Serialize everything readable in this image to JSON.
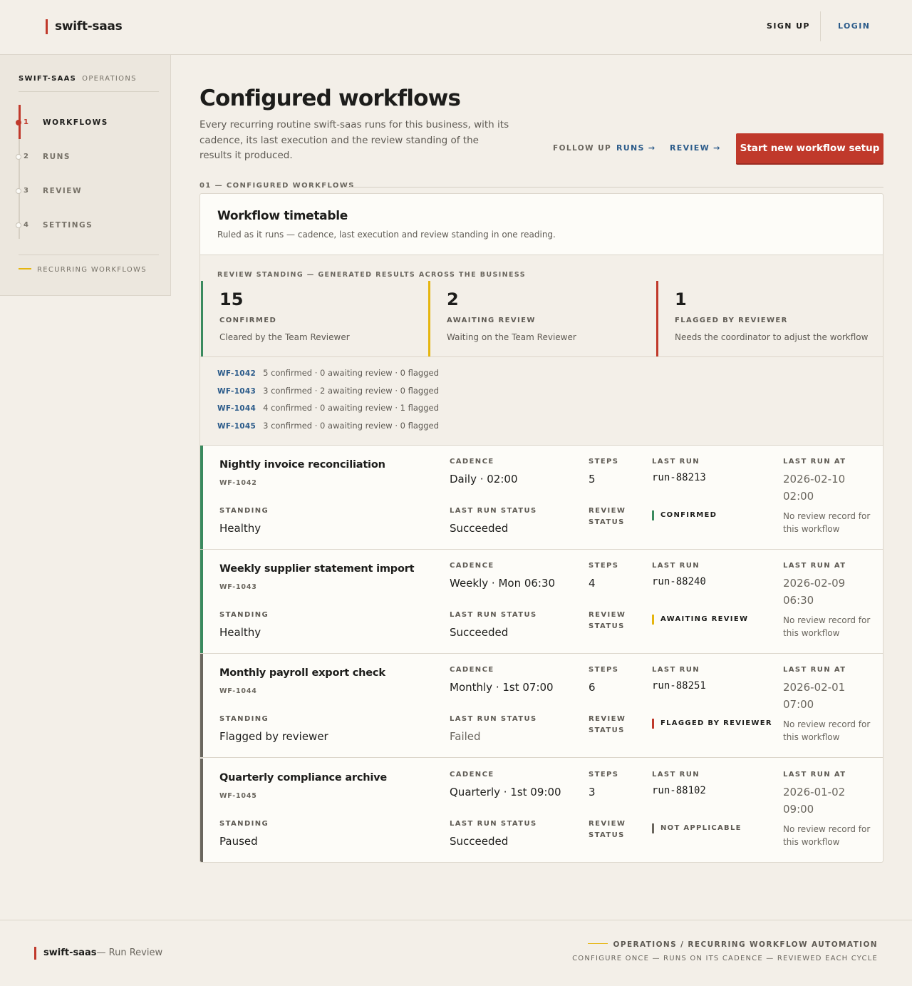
{
  "header": {
    "brand": "swift-saas",
    "signup": "SIGN UP",
    "login": "LOGIN"
  },
  "sidebar": {
    "title_a": "SWIFT-SAAS",
    "title_b": "OPERATIONS",
    "items": [
      {
        "num": "1",
        "label": "WORKFLOWS",
        "active": true
      },
      {
        "num": "2",
        "label": "RUNS",
        "active": false
      },
      {
        "num": "3",
        "label": "REVIEW",
        "active": false
      },
      {
        "num": "4",
        "label": "SETTINGS",
        "active": false
      }
    ],
    "footer": "RECURRING WORKFLOWS"
  },
  "main": {
    "title": "Configured workflows",
    "lead": "Every recurring routine swift-saas runs for this business, with its cadence, its last execution and the review standing of the results it produced.",
    "follow_up": "FOLLOW UP",
    "runs_link": "RUNS →",
    "review_link": "REVIEW →",
    "cta": "Start new workflow setup",
    "section_label": "01 — CONFIGURED WORKFLOWS"
  },
  "card": {
    "title": "Workflow timetable",
    "subtitle": "Ruled as it runs — cadence, last execution and review standing in one reading.",
    "summary_label": "REVIEW STANDING — GENERATED RESULTS ACROSS THE BUSINESS",
    "stats": [
      {
        "value": "15",
        "label": "CONFIRMED",
        "desc": "Cleared by the Team Reviewer",
        "color": "#3a8a5e"
      },
      {
        "value": "2",
        "label": "AWAITING REVIEW",
        "desc": "Waiting on the Team Reviewer",
        "color": "#e5b50f"
      },
      {
        "value": "1",
        "label": "FLAGGED BY REVIEWER",
        "desc": "Needs the coordinator to adjust the workflow",
        "color": "#c0392b"
      }
    ],
    "breakdown": [
      {
        "id": "WF-1042",
        "text": "5 confirmed · 0 awaiting review · 0 flagged"
      },
      {
        "id": "WF-1043",
        "text": "3 confirmed · 2 awaiting review · 0 flagged"
      },
      {
        "id": "WF-1044",
        "text": "4 confirmed · 0 awaiting review · 1 flagged"
      },
      {
        "id": "WF-1045",
        "text": "3 confirmed · 0 awaiting review · 0 flagged"
      }
    ]
  },
  "labels": {
    "cadence": "CADENCE",
    "steps": "STEPS",
    "last_run": "LAST RUN",
    "last_run_at": "LAST RUN AT",
    "standing": "STANDING",
    "last_run_status": "LAST RUN STATUS",
    "review_status_1": "REVIEW",
    "review_status_2": "STATUS"
  },
  "workflows": [
    {
      "name": "Nightly invoice reconciliation",
      "id": "WF-1042",
      "cadence": "Daily · 02:00",
      "steps": "5",
      "last_run": "run-88213",
      "last_run_at_1": "2026-02-10",
      "last_run_at_2": "02:00",
      "standing": "Healthy",
      "last_run_status": "Succeeded",
      "review_status": "CONFIRMED",
      "review_color": "#3a8a5e",
      "note": "No review record for this workflow",
      "stripe": "#3a8a5e"
    },
    {
      "name": "Weekly supplier statement import",
      "id": "WF-1043",
      "cadence": "Weekly · Mon 06:30",
      "steps": "4",
      "last_run": "run-88240",
      "last_run_at_1": "2026-02-09",
      "last_run_at_2": "06:30",
      "standing": "Healthy",
      "last_run_status": "Succeeded",
      "review_status": "AWAITING REVIEW",
      "review_color": "#e5b50f",
      "note": "No review record for this workflow",
      "stripe": "#3a8a5e"
    },
    {
      "name": "Monthly payroll export check",
      "id": "WF-1044",
      "cadence": "Monthly · 1st 07:00",
      "steps": "6",
      "last_run": "run-88251",
      "last_run_at_1": "2026-02-01",
      "last_run_at_2": "07:00",
      "standing": "Flagged by reviewer",
      "last_run_status": "Failed",
      "review_status": "FLAGGED BY REVIEWER",
      "review_color": "#c0392b",
      "note": "No review record for this workflow",
      "stripe": "#6a665e"
    },
    {
      "name": "Quarterly compliance archive",
      "id": "WF-1045",
      "cadence": "Quarterly · 1st 09:00",
      "steps": "3",
      "last_run": "run-88102",
      "last_run_at_1": "2026-01-02",
      "last_run_at_2": "09:00",
      "standing": "Paused",
      "last_run_status": "Succeeded",
      "review_status": "NOT APPLICABLE",
      "review_color": "#6a665e",
      "note": "No review record for this workflow",
      "stripe": "#6a665e"
    }
  ],
  "footer": {
    "brand": "swift-saas",
    "suffix": "— Run Review",
    "right1": "OPERATIONS / RECURRING WORKFLOW AUTOMATION",
    "right2": "CONFIGURE ONCE — RUNS ON ITS CADENCE — REVIEWED EACH CYCLE"
  }
}
